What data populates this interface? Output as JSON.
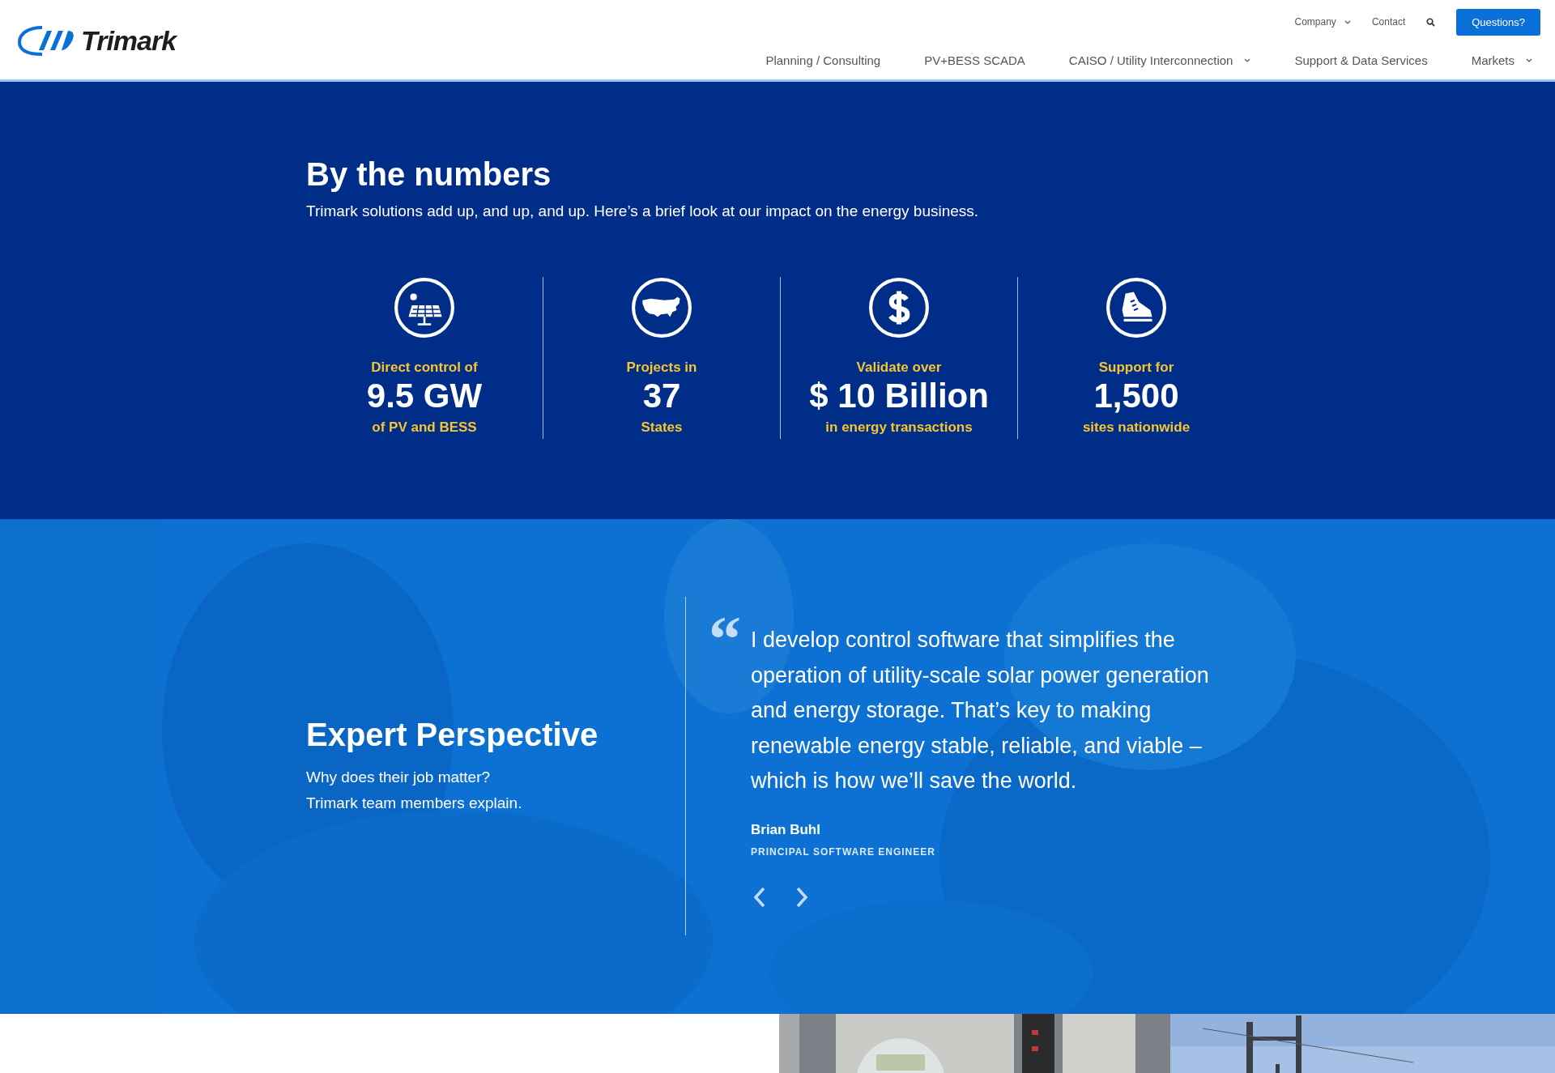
{
  "header": {
    "logo": "Trimark",
    "top_nav": [
      {
        "label": "Company",
        "dropdown": true
      },
      {
        "label": "Contact",
        "dropdown": false
      }
    ],
    "cta": "Questions?",
    "main_nav": [
      {
        "label": "Planning / Consulting",
        "dropdown": false
      },
      {
        "label": "PV+BESS SCADA",
        "dropdown": false
      },
      {
        "label": "CAISO / Utility Interconnection",
        "dropdown": true
      },
      {
        "label": "Support & Data Services",
        "dropdown": false
      },
      {
        "label": "Markets",
        "dropdown": true
      }
    ]
  },
  "numbers": {
    "title": "By the numbers",
    "subtitle": "Trimark solutions add up, and up, and up. Here’s a brief look at our impact on the energy business.",
    "stats": [
      {
        "kind": "solar",
        "label": "Direct control of",
        "value": "9.5 GW",
        "caption": "of PV and BESS"
      },
      {
        "kind": "map",
        "label": "Projects in",
        "value": "37",
        "caption": "States"
      },
      {
        "kind": "dollar",
        "label": "Validate over",
        "value": "$ 10 Billion",
        "caption": "in energy transactions"
      },
      {
        "kind": "shoe",
        "label": "Support for",
        "value": "1,500",
        "caption": "sites nationwide"
      }
    ]
  },
  "perspective": {
    "title": "Expert Perspective",
    "subtitle_lines": [
      "Why does their job matter?",
      "Trimark team members explain."
    ],
    "quote_mark": "“",
    "quote": "I develop control software that simplifies the operation of utility-scale solar power generation and energy storage. That’s key to making renewable energy stable, reliable, and viable – which is how we’ll save the world.",
    "name": "Brian Buhl",
    "role": "PRINCIPAL SOFTWARE ENGINEER"
  }
}
